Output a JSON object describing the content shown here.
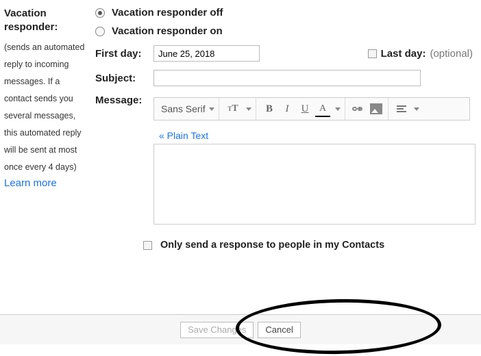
{
  "sidebar": {
    "title_line1": "Vacation",
    "title_line2": "responder:",
    "desc": "(sends an automated reply to incoming messages. If a contact sends you several messages, this automated reply will be sent at most once every 4 days)",
    "learn_more": "Learn more"
  },
  "radios": {
    "off": "Vacation responder off",
    "on": "Vacation responder on",
    "selected": "off"
  },
  "fields": {
    "first_day_label": "First day:",
    "first_day_value": "June 25, 2018",
    "last_day_label": "Last day:",
    "last_day_optional": "(optional)",
    "subject_label": "Subject:",
    "subject_value": "",
    "message_label": "Message:"
  },
  "toolbar": {
    "font": "Sans Serif"
  },
  "plain_text": "« Plain Text",
  "contacts": {
    "label": "Only send a response to people in my Contacts"
  },
  "footer": {
    "save": "Save Changes",
    "cancel": "Cancel"
  }
}
